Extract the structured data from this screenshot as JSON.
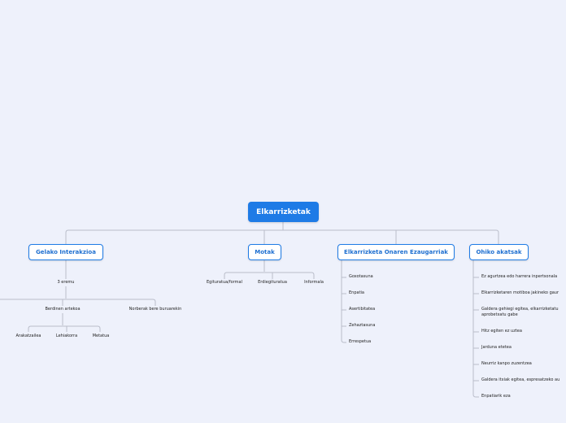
{
  "root": {
    "label": "Elkarrizketak"
  },
  "branches": {
    "gelako": {
      "label": "Gelako Interakzioa",
      "eremu": "3 eremu",
      "berdinen": "Berdinen artekoa",
      "norberak": "Norberak bere buruarekin",
      "sub": [
        "Arakatzailea",
        "Lehiakorra",
        "Metatua"
      ]
    },
    "motak": {
      "label": "Motak",
      "items": [
        "Egituratua/formal",
        "Erdiegituratua",
        "Informala"
      ]
    },
    "ezaugarriak": {
      "label": "Elkarrizketa Onaren Ezaugarriak",
      "items": [
        "Goxotasuna",
        "Enpatia",
        "Asertibitatea",
        "Zehaztasuna",
        "Errespetua"
      ]
    },
    "akatsak": {
      "label": "Ohiko akatsak",
      "items": [
        "Ez agurtzea edo harrera inpertsonala",
        "Elkarrizketaren motiboa jakineko gaur",
        "Galdera gehiegi egitea, elkarrizketatu",
        "aprobetxatu gabe",
        "Hitz egiten ez uztea",
        "Jarduna etetea",
        "Neurriz kanpo zuzentzea",
        "Galdera itxiak egitea, espresatzeko au",
        "Enpatiarik eza"
      ]
    }
  }
}
